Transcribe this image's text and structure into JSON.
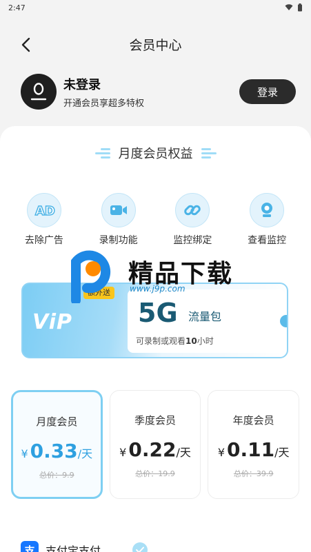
{
  "status_bar": {
    "time": "2:47"
  },
  "header": {
    "title": "会员中心"
  },
  "user": {
    "name": "未登录",
    "subtitle": "开通会员享超多特权",
    "login_label": "登录"
  },
  "benefits": {
    "title": "月度会员权益",
    "items": [
      {
        "label": "去除广告",
        "icon": "ad-block-icon"
      },
      {
        "label": "录制功能",
        "icon": "video-camera-icon"
      },
      {
        "label": "监控绑定",
        "icon": "link-icon"
      },
      {
        "label": "查看监控",
        "icon": "webcam-icon"
      }
    ]
  },
  "vip_card": {
    "logo": "ViP",
    "ribbon": "额外送",
    "data_size": "5G",
    "data_unit": "流量包",
    "note_prefix": "可录制或观看",
    "note_hours": "10",
    "note_suffix": "小时"
  },
  "watermark": {
    "text": "精品下载",
    "url": "www.j9p.com"
  },
  "plans": [
    {
      "name": "月度会员",
      "currency": "¥",
      "price": "0.33",
      "per": "/天",
      "original": "总价：9.9",
      "selected": true
    },
    {
      "name": "季度会员",
      "currency": "¥",
      "price": "0.22",
      "per": "/天",
      "original": "总价：19.9",
      "selected": false
    },
    {
      "name": "年度会员",
      "currency": "¥",
      "price": "0.11",
      "per": "/天",
      "original": "总价：39.9",
      "selected": false
    }
  ],
  "payment": {
    "label": "支付宝支付",
    "icon_char": "支"
  },
  "colors": {
    "accent": "#2ea0e0",
    "light_accent": "#7ecff2",
    "dark_button": "#2b2b2b",
    "alipay": "#1677ff"
  }
}
